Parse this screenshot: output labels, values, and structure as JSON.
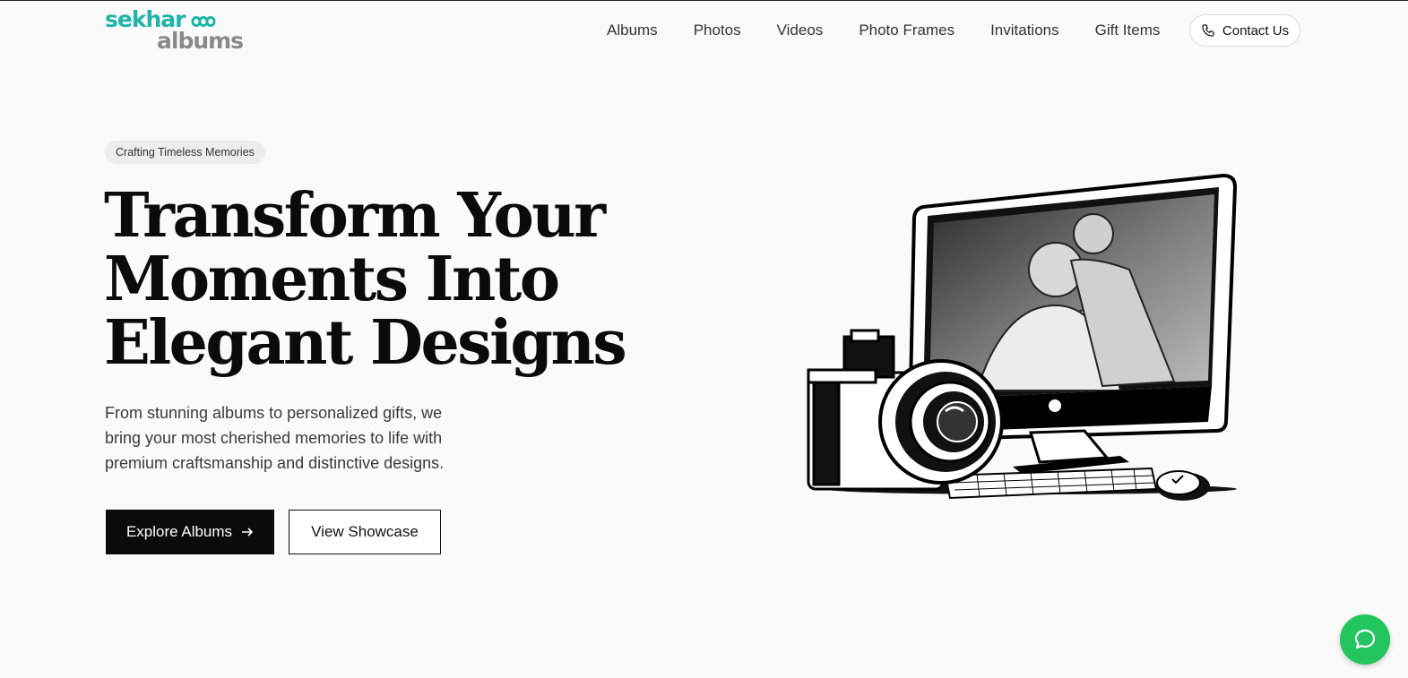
{
  "brand": {
    "line1": "sekhar",
    "line2": "albums",
    "teal": "#1fb5a8",
    "grey": "#8a8a8a"
  },
  "nav": {
    "items": [
      "Albums",
      "Photos",
      "Videos",
      "Photo Frames",
      "Invitations",
      "Gift Items"
    ],
    "contact_label": "Contact Us",
    "contact_icon": "phone-icon"
  },
  "hero": {
    "badge": "Crafting Timeless Memories",
    "headline": [
      "Transform Your",
      "Moments Into",
      "Elegant Designs"
    ],
    "subtext": "From stunning albums to personalized gifts, we bring your most cherished memories to life with premium craftsmanship and distinctive designs.",
    "primary_button": "Explore Albums",
    "primary_icon": "arrow-right-icon",
    "secondary_button": "View Showcase",
    "illustration_icon": "camera-and-computer-illustration"
  },
  "chat": {
    "icon": "chat-bubble-icon",
    "color": "#22c55e"
  }
}
